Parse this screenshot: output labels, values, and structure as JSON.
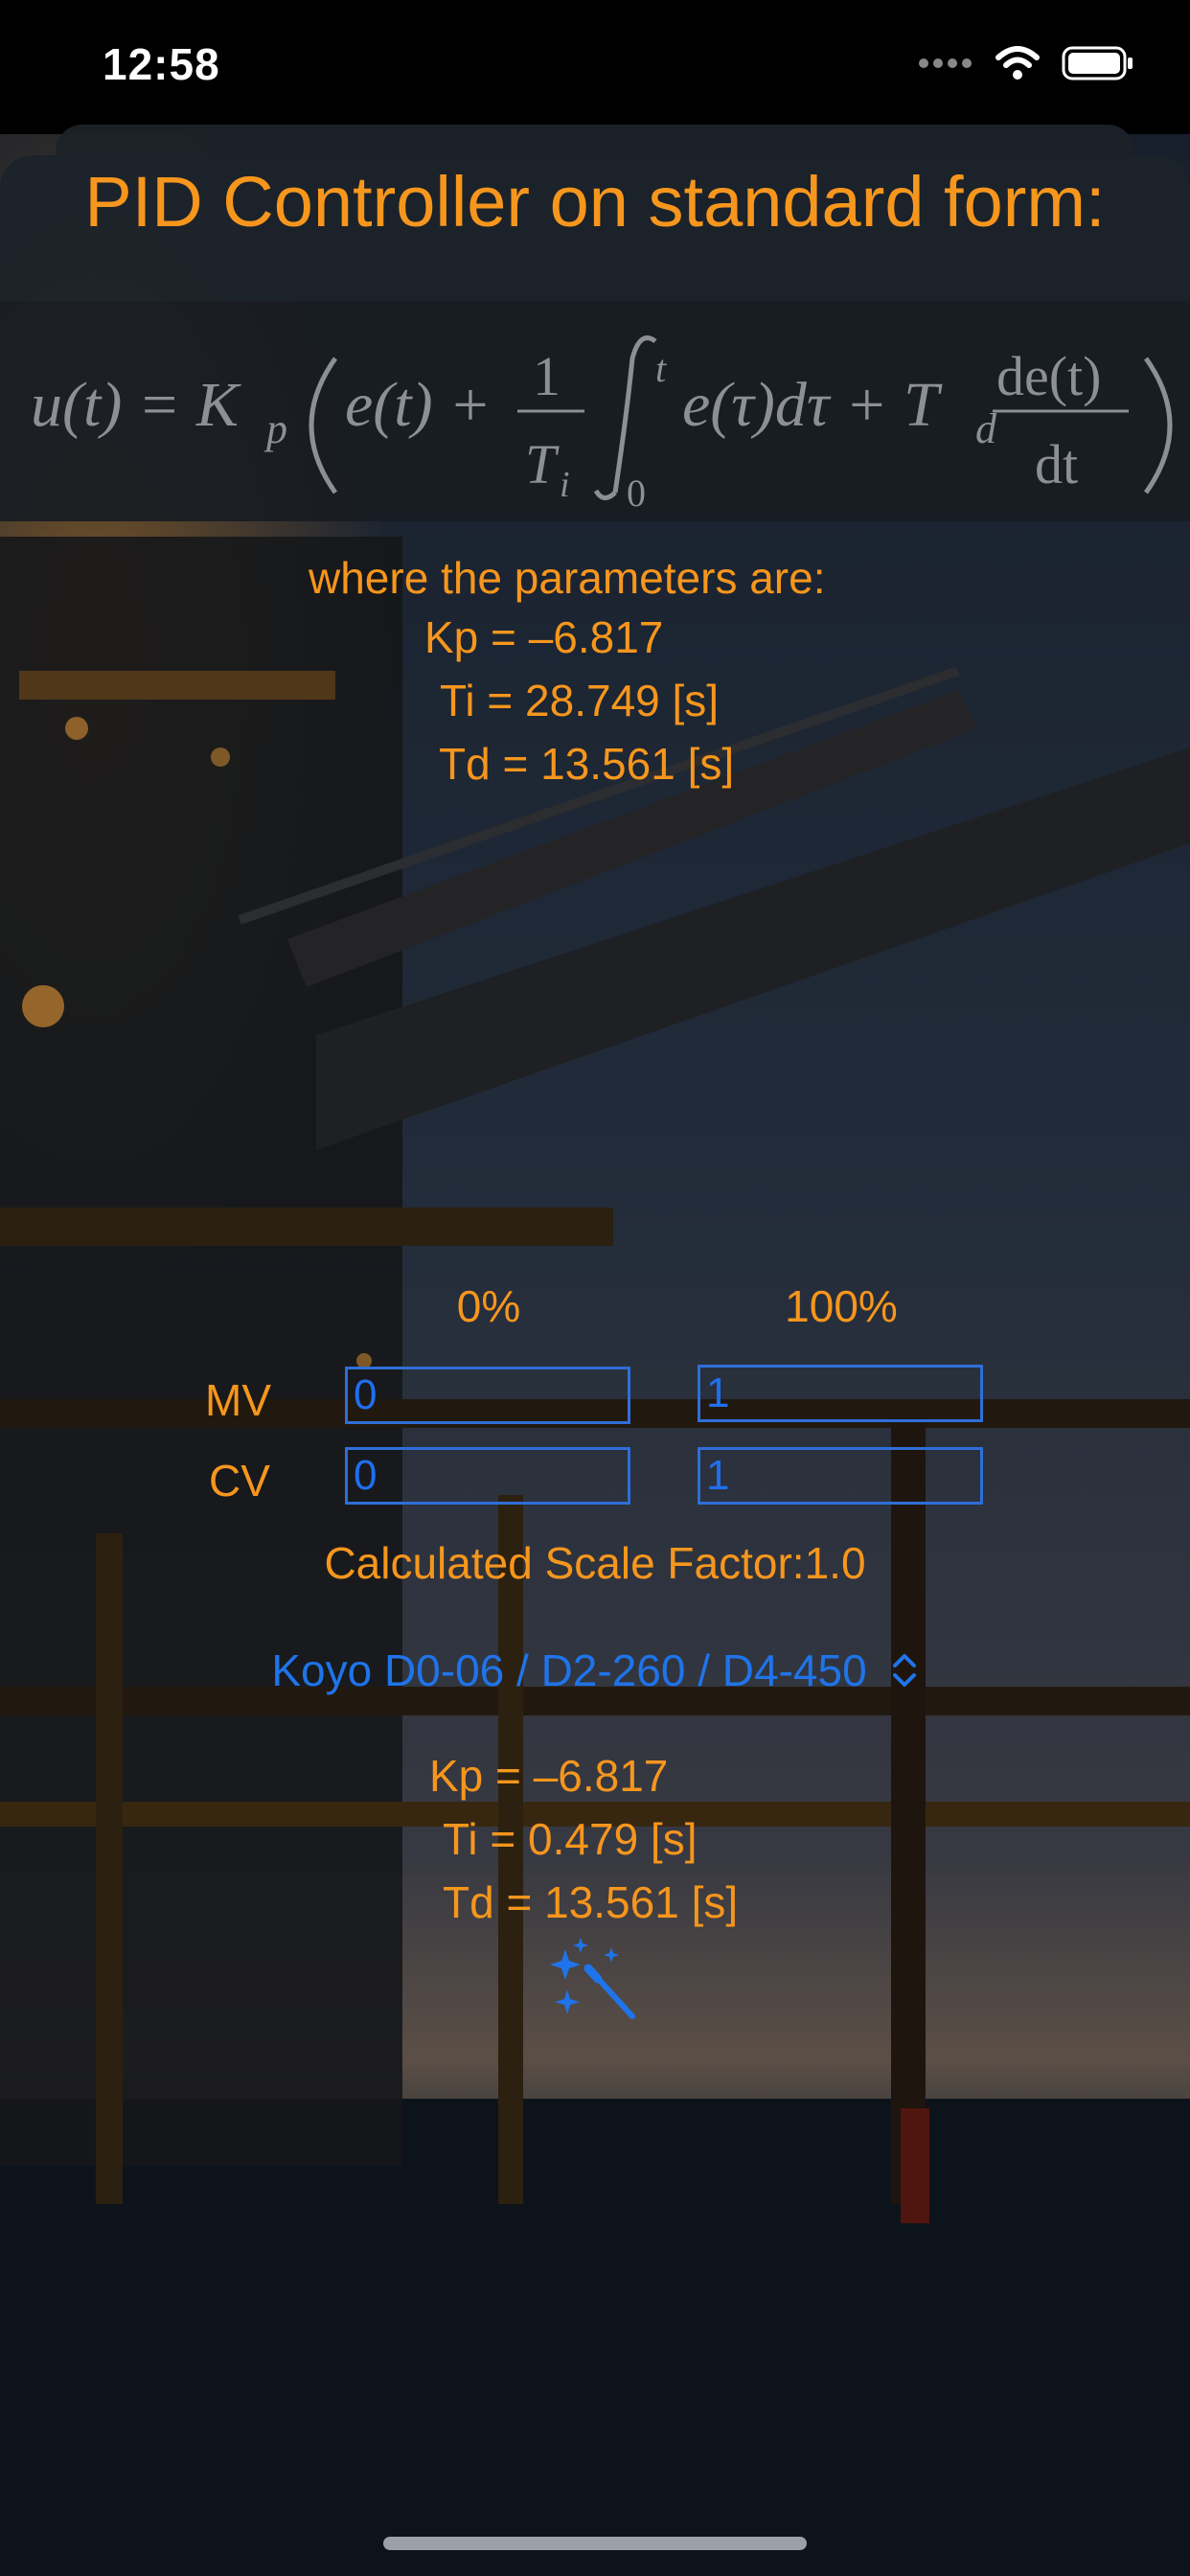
{
  "status_bar": {
    "time": "12:58"
  },
  "title": "PID Controller on standard form:",
  "formula": {
    "lhs": "u(t) = K",
    "kp_sub": "p",
    "e_t": "e(t) +",
    "frac_num": "1",
    "frac_den": "T",
    "den_sub": "i",
    "int_upper": "t",
    "int_lower": "0",
    "integrand": "e(τ)dτ + T",
    "td_sub": "d",
    "deriv_num": "de(t)",
    "deriv_den": "dt"
  },
  "standard_params": {
    "intro": "where the parameters are:",
    "kp": "Kp = –6.817",
    "ti": "Ti = 28.749 [s]",
    "td": "Td = 13.561 [s]"
  },
  "scaling": {
    "col_min": "0%",
    "col_max": "100%",
    "mv_label": "MV",
    "cv_label": "CV",
    "mv_min": "0",
    "mv_max": "1",
    "cv_min": "0",
    "cv_max": "1",
    "scale_factor": "Calculated Scale Factor:1.0"
  },
  "controller_picker": {
    "selected": "Koyo D0-06 / D2-260 / D4-450"
  },
  "converted_params": {
    "kp": "Kp = –6.817",
    "ti": "Ti = 0.479 [s]",
    "td": "Td = 13.561 [s]"
  },
  "colors": {
    "accent_orange": "#f6961d",
    "link_blue": "#1f74ea"
  },
  "icons": {
    "picker": "chevron-up-down-icon",
    "convert": "magic-wand-icon"
  }
}
